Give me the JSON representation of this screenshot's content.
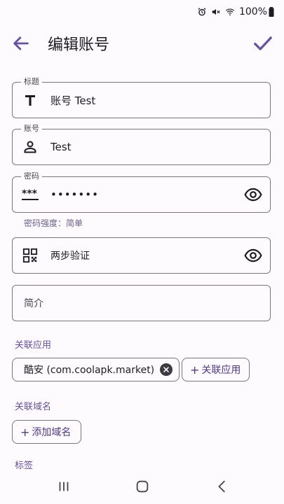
{
  "status_bar": {
    "battery_text": "100%",
    "icons": [
      "alarm-icon",
      "mute-icon",
      "wifi-icon",
      "battery-icon"
    ]
  },
  "app_bar": {
    "title": "编辑账号",
    "back_icon": "arrow-back-icon",
    "save_icon": "check-icon"
  },
  "form": {
    "title_field": {
      "label": "标题",
      "value": "账号 Test",
      "icon": "text-title-icon"
    },
    "account_field": {
      "label": "账号",
      "value": "Test",
      "icon": "person-icon"
    },
    "password_field": {
      "label": "密码",
      "value": "•••••••",
      "icon": "password-icon",
      "trailing_icon": "eye-icon"
    },
    "password_strength": "密码强度：简单",
    "twofa_field": {
      "placeholder": "两步验证",
      "icon": "qr-code-icon",
      "trailing_icon": "eye-icon"
    },
    "intro_field": {
      "placeholder": "简介"
    }
  },
  "linked_apps": {
    "title": "关联应用",
    "chips": [
      {
        "label": "酷安 (com.coolapk.market)"
      }
    ],
    "add_label": "关联应用"
  },
  "linked_domains": {
    "title": "关联域名",
    "add_label": "添加域名"
  },
  "tags": {
    "title": "标签"
  },
  "colors": {
    "accent": "#6750a4",
    "outline": "#79747e",
    "background": "#fefbff"
  }
}
